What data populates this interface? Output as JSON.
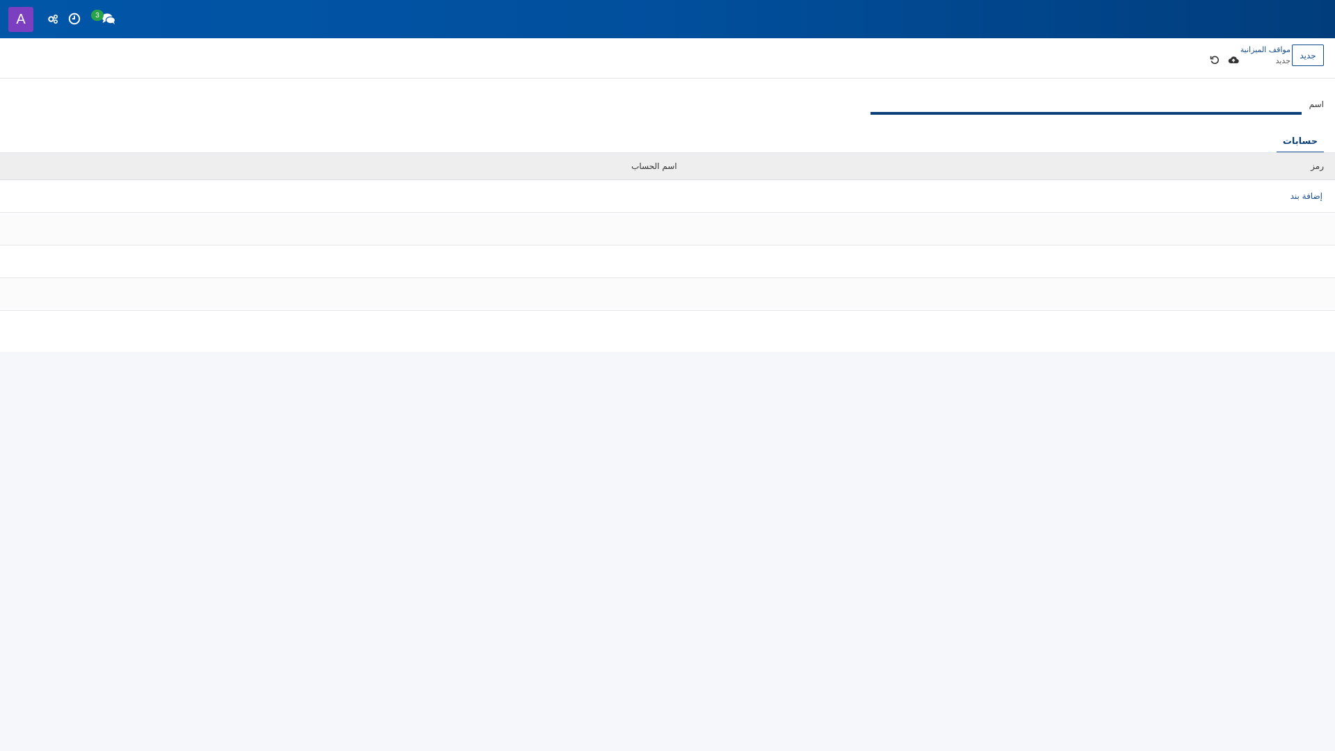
{
  "navbar": {
    "avatar_letter": "A",
    "chat_badge_count": "3",
    "icons": [
      "activity-settings-icon",
      "clock-icon",
      "chat-icon"
    ]
  },
  "control_panel": {
    "new_button_label": "جديد",
    "breadcrumb_parent": "مواقف الميزانية",
    "breadcrumb_current": "جديد",
    "icons": [
      "cloud-upload-icon",
      "undo-icon"
    ]
  },
  "form": {
    "name_label": "اسم",
    "name_value": ""
  },
  "tabs": [
    {
      "label": "حسابات"
    }
  ],
  "table": {
    "columns": [
      "رمز",
      "اسم الحساب"
    ],
    "add_line_label": "إضافة بند"
  },
  "colors": {
    "navbar": "#0156a8",
    "avatar": "#7b3fbf",
    "badge": "#29a34a",
    "accent": "#0a4a8c"
  }
}
